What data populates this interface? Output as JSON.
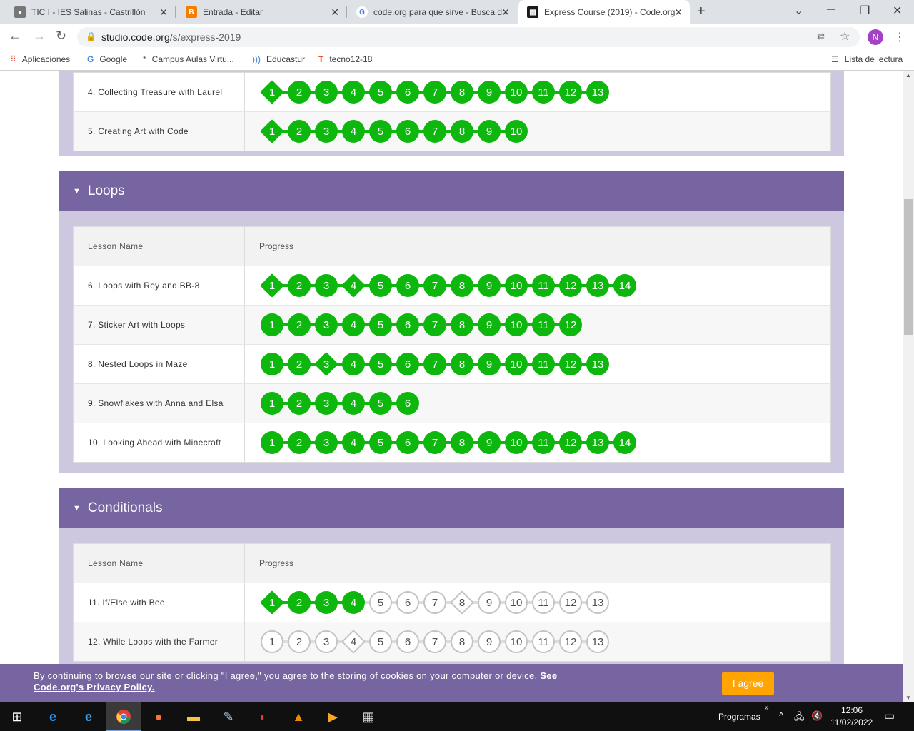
{
  "browser": {
    "tabs": [
      {
        "title": "TIC I - IES Salinas - Castrillón",
        "favicon": "avatar-favicon-icon"
      },
      {
        "title": "Entrada - Editar",
        "favicon": "blogger-favicon-icon"
      },
      {
        "title": "code.org para que sirve - Busca d",
        "favicon": "google-favicon-icon"
      },
      {
        "title": "Express Course (2019) - Code.org",
        "favicon": "code-org-favicon-icon"
      }
    ],
    "url_host": "studio.code.org",
    "url_path": "/s/express-2019",
    "profile_initial": "N",
    "bookmarks": [
      {
        "label": "Aplicaciones",
        "icon": "apps-grid-icon"
      },
      {
        "label": "Google",
        "icon": "google-icon"
      },
      {
        "label": "Campus Aulas Virtu...",
        "icon": "campus-icon"
      },
      {
        "label": "Educastur",
        "icon": "educastur-icon"
      },
      {
        "label": "tecno12-18",
        "icon": "tecno-icon"
      }
    ],
    "reading_list": "Lista de lectura"
  },
  "sections": [
    {
      "title": "",
      "lessons": [
        {
          "name": "4. Collecting Treasure with Laurel",
          "levels": 13,
          "done": 13,
          "diamonds": [
            1
          ]
        },
        {
          "name": "5. Creating Art with Code",
          "levels": 10,
          "done": 10,
          "diamonds": [
            1
          ]
        }
      ]
    },
    {
      "title": "Loops",
      "header": {
        "lesson_name": "Lesson Name",
        "progress": "Progress"
      },
      "lessons": [
        {
          "name": "6. Loops with Rey and BB-8",
          "levels": 14,
          "done": 14,
          "diamonds": [
            1,
            4
          ]
        },
        {
          "name": "7. Sticker Art with Loops",
          "levels": 12,
          "done": 12,
          "diamonds": []
        },
        {
          "name": "8. Nested Loops in Maze",
          "levels": 13,
          "done": 13,
          "diamonds": [
            3
          ]
        },
        {
          "name": "9. Snowflakes with Anna and Elsa",
          "levels": 6,
          "done": 6,
          "diamonds": []
        },
        {
          "name": "10. Looking Ahead with Minecraft",
          "levels": 14,
          "done": 14,
          "diamonds": []
        }
      ]
    },
    {
      "title": "Conditionals",
      "header": {
        "lesson_name": "Lesson Name",
        "progress": "Progress"
      },
      "lessons": [
        {
          "name": "11. If/Else with Bee",
          "levels": 13,
          "done": 4,
          "diamonds": [
            1,
            8
          ]
        },
        {
          "name": "12. While Loops with the Farmer",
          "levels": 13,
          "done": 0,
          "diamonds": [
            4
          ]
        }
      ]
    }
  ],
  "cookie": {
    "message": "By continuing to browse our site or clicking \"I agree,\" you agree to the storing of cookies on your computer or device.",
    "link": "See Code.org's Privacy Policy.",
    "button": "I agree"
  },
  "taskbar": {
    "programs_label": "Programas",
    "time": "12:06",
    "date": "11/02/2022"
  },
  "colors": {
    "section_header": "#7665a0",
    "section_bg": "#cdc7e0",
    "level_done": "#0eb70e",
    "level_todo_border": "#c4c4c4",
    "cookie_button": "#ffa400"
  }
}
